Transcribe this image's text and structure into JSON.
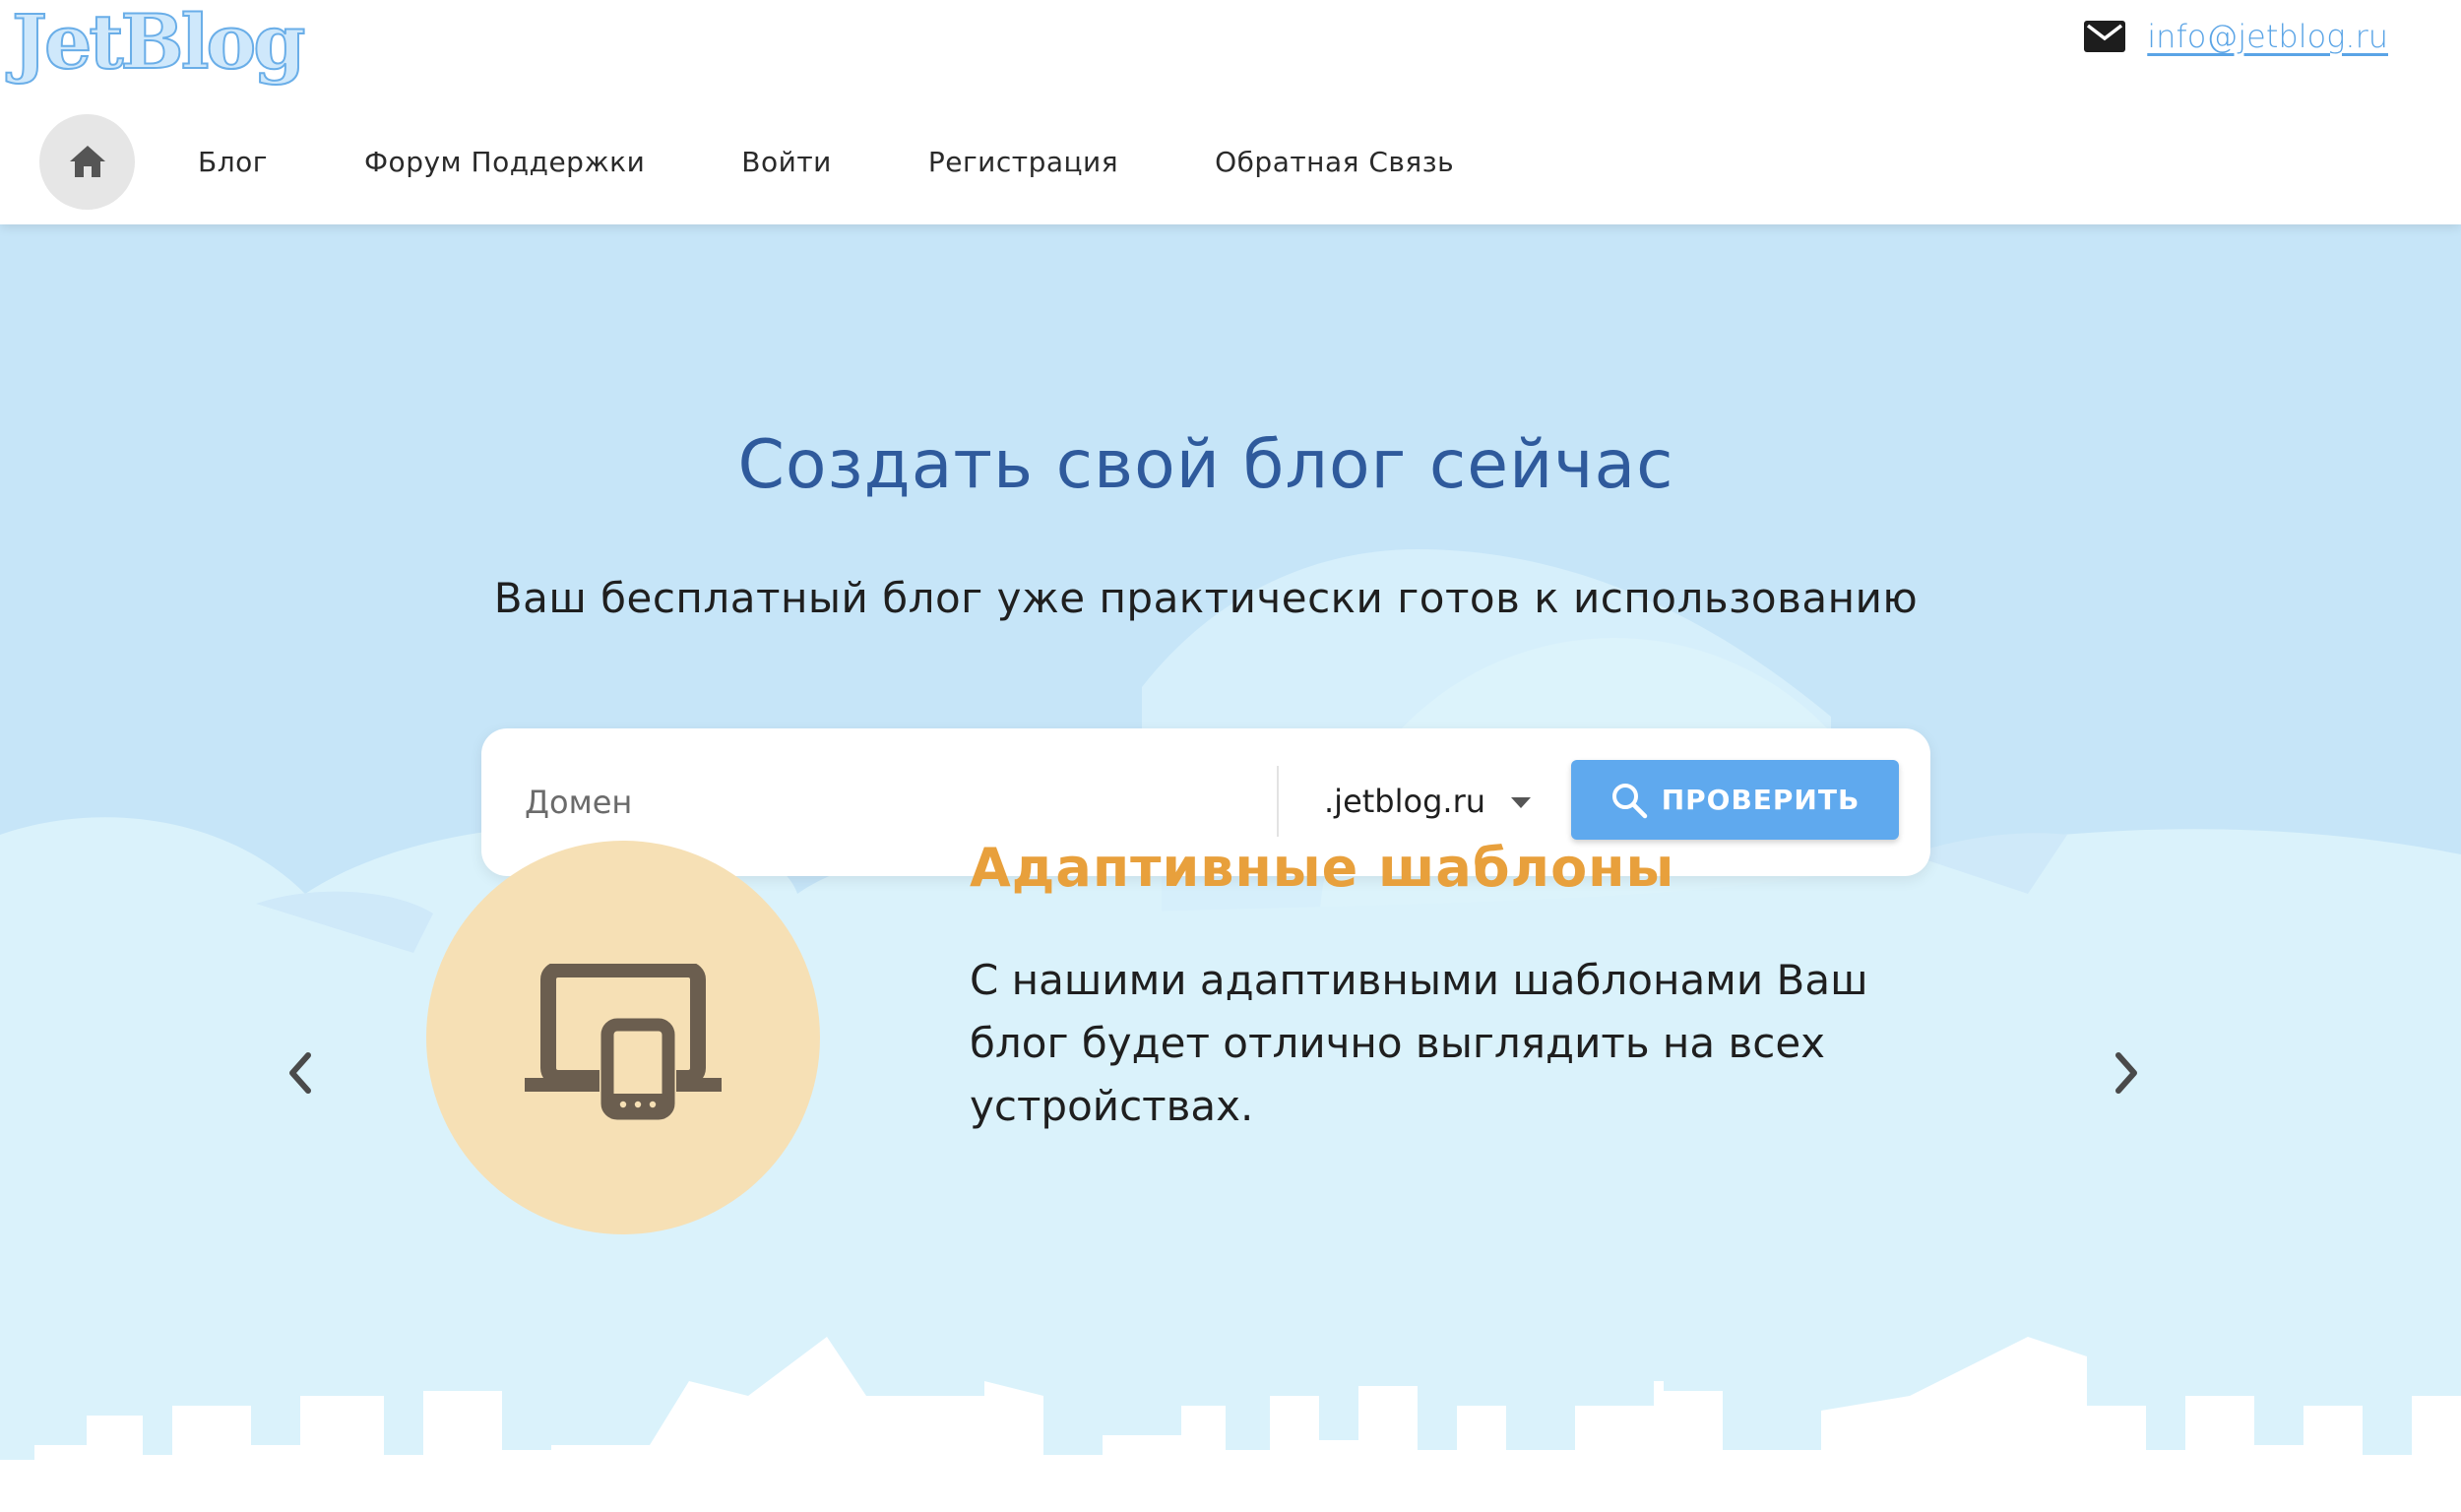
{
  "header": {
    "logo_text": "JetBlog",
    "contact_email": "info@jetblog.ru",
    "icons": {
      "mail": "mail-icon",
      "home": "home-icon"
    }
  },
  "nav": {
    "items": [
      {
        "label": "Блог"
      },
      {
        "label": "Форум Поддержки"
      },
      {
        "label": "Войти"
      },
      {
        "label": "Регистрация"
      },
      {
        "label": "Обратная Связь"
      }
    ]
  },
  "hero": {
    "title": "Создать свой блог сейчас",
    "subtitle": "Ваш бесплатный блог уже практически готов к использованию"
  },
  "search": {
    "placeholder": "Домен",
    "zone_value": ".jetblog.ru",
    "button_label": "ПРОВЕРИТЬ",
    "button_icon": "search-icon"
  },
  "slide": {
    "title": "Адаптивные шаблоны",
    "text": "С нашими адаптивными шаблонами Ваш блог будет отлично выглядить на всех устройствах.",
    "icon": "devices-icon"
  },
  "colors": {
    "accent_blue": "#5fa9ee",
    "title_blue": "#2f5a9c",
    "slide_orange": "#e8a03c",
    "sky": "#c6e5f8",
    "circle": "#f6e0b5"
  }
}
